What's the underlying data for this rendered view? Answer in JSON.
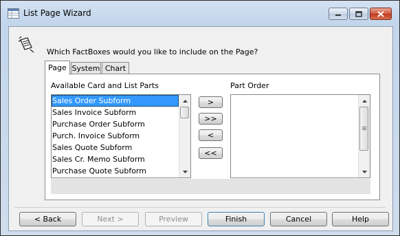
{
  "window": {
    "title": "List Page Wizard"
  },
  "question": "Which FactBoxes would you like to include on the Page?",
  "tabs": [
    {
      "label": "Page",
      "active": true
    },
    {
      "label": "System",
      "active": false
    },
    {
      "label": "Chart",
      "active": false
    }
  ],
  "available": {
    "label": "Available Card and List Parts",
    "items": [
      "Sales Order Subform",
      "Sales Invoice Subform",
      "Purchase Order Subform",
      "Purch. Invoice Subform",
      "Sales Quote Subform",
      "Sales Cr. Memo Subform",
      "Purchase Quote Subform"
    ],
    "selected": "Sales Order Subform"
  },
  "part_order": {
    "label": "Part Order",
    "items": []
  },
  "move_buttons": {
    "add": ">",
    "add_all": ">>",
    "remove": "<",
    "remove_all": "<<"
  },
  "buttons": {
    "back": "< Back",
    "next": "Next >",
    "preview": "Preview",
    "finish": "Finish",
    "cancel": "Cancel",
    "help": "Help"
  }
}
